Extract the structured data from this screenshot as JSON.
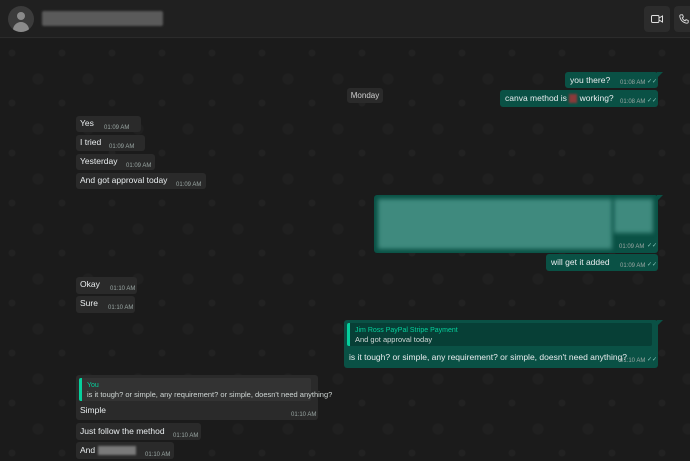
{
  "header": {
    "contact_name": "",
    "video_icon": "video-call-icon",
    "call_icon": "phone-icon"
  },
  "day_separator": "Monday",
  "outgoing_1": {
    "text": "you there?",
    "time": "01:08 AM"
  },
  "outgoing_2": {
    "text_before": "canva method is ",
    "text_after": " working?",
    "time": "01:08 AM"
  },
  "incoming_1": {
    "text": "Yes",
    "time": "01:09 AM"
  },
  "incoming_2": {
    "text": "I tried",
    "time": "01:09 AM"
  },
  "incoming_3": {
    "text": "Yesterday",
    "time": "01:09 AM"
  },
  "incoming_4": {
    "text": "And got approval today",
    "time": "01:09 AM"
  },
  "outgoing_image": {
    "time": "01:09 AM"
  },
  "outgoing_3": {
    "text": "will get it added",
    "time": "01:09 AM"
  },
  "incoming_5": {
    "text": "Okay",
    "time": "01:10 AM"
  },
  "incoming_6": {
    "text": "Sure",
    "time": "01:10 AM"
  },
  "outgoing_reply": {
    "quote_author": "Jim Ross PayPal Stripe Payment",
    "quote_text": "And got approval today",
    "text": "is it tough? or simple, any requirement? or simple, doesn't need anything?",
    "time": "01:10 AM"
  },
  "incoming_reply": {
    "quote_author": "You",
    "quote_text": "is it tough? or simple, any requirement? or simple, doesn't need anything?",
    "text": "Simple",
    "time": "01:10 AM"
  },
  "incoming_7": {
    "text": "Just follow the method",
    "time": "01:10 AM"
  },
  "incoming_8": {
    "text": "And",
    "time": "01:10 AM"
  },
  "ticks": "✓✓",
  "colors": {
    "outgoing_bubble": "#0a5145",
    "incoming_bubble": "#2a2a2a",
    "accent": "#06cf9c"
  }
}
